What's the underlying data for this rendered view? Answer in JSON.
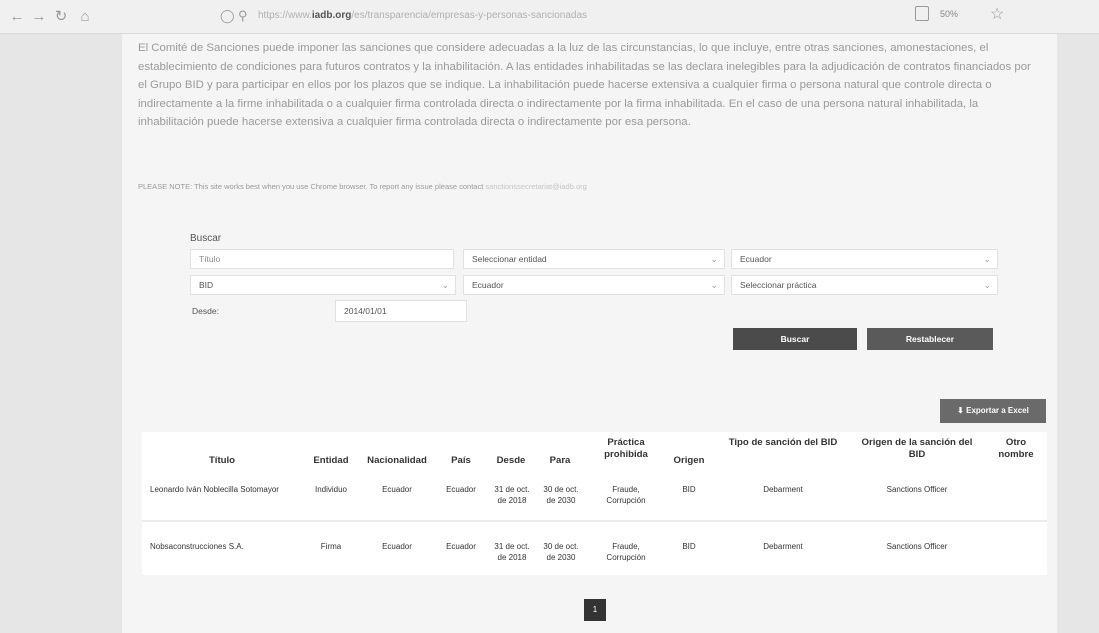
{
  "browser": {
    "url_prefix": "https://www.",
    "url_domain": "iadb.org",
    "url_path": "/es/transparencia/empresas-y-personas-sancionadas",
    "zoom": "50%"
  },
  "intro": {
    "text": "El Comité de Sanciones puede imponer las sanciones que considere adecuadas a la luz de las circunstancias, lo que incluye, entre otras sanciones, amonestaciones, el establecimiento de condiciones para futuros contratos y la inhabilitación. A las entidades inhabilitadas se las declara inelegibles para la adjudicación de contratos financiados por el Grupo BID y para participar en ellos por los plazos que se indique. La inhabilitación puede hacerse extensiva a cualquier firma o persona natural que controle directa o indirectamente a la firme inhabilitada o a cualquier firma controlada directa o indirectamente por la firma inhabilitada. En el caso de una persona natural inhabilitada, la inhabilitación puede hacerse extensiva a cualquier firma controlada directa o indirectamente por esa persona.",
    "note": "PLEASE NOTE: This site works best when you use Chrome browser. To report any issue please contact",
    "note_email": "sanctionssecretariat@iadb.org"
  },
  "search": {
    "label": "Buscar",
    "titulo_placeholder": "Título",
    "entidad": "Seleccionar entidad",
    "country_a": "Ecuador",
    "origen": "BID",
    "country_b": "Ecuador",
    "practica": "Seleccionar práctica",
    "desde_label": "Desde:",
    "desde_value": "2014/01/01",
    "buscar_btn": "Buscar",
    "reset_btn": "Restablecer",
    "export_btn": "Exportar a Excel"
  },
  "table": {
    "headers": {
      "titulo": "Título",
      "entidad": "Entidad",
      "nacionalidad": "Nacionalidad",
      "pais": "País",
      "desde": "Desde",
      "para": "Para",
      "practica": "Práctica prohibida",
      "origen": "Origen",
      "tipo": "Tipo de sanción del BID",
      "origen_sancion": "Origen de la sanción del BID",
      "otro": "Otro nombre"
    },
    "rows": [
      {
        "titulo": "Leonardo Iván Noblecilla Sotomayor",
        "entidad": "Individuo",
        "nacionalidad": "Ecuador",
        "pais": "Ecuador",
        "desde": "31 de oct. de 2018",
        "para": "30 de oct. de 2030",
        "practica": "Fraude, Corrupción",
        "origen": "BID",
        "tipo": "Debarment",
        "origen_sancion": "Sanctions Officer",
        "otro": ""
      },
      {
        "titulo": "Nobsaconstrucciones S.A.",
        "entidad": "Firma",
        "nacionalidad": "Ecuador",
        "pais": "Ecuador",
        "desde": "31 de oct. de 2018",
        "para": "30 de oct. de 2030",
        "practica": "Fraude, Corrupción",
        "origen": "BID",
        "tipo": "Debarment",
        "origen_sancion": "Sanctions Officer",
        "otro": ""
      }
    ]
  },
  "pagination": {
    "current": "1"
  }
}
